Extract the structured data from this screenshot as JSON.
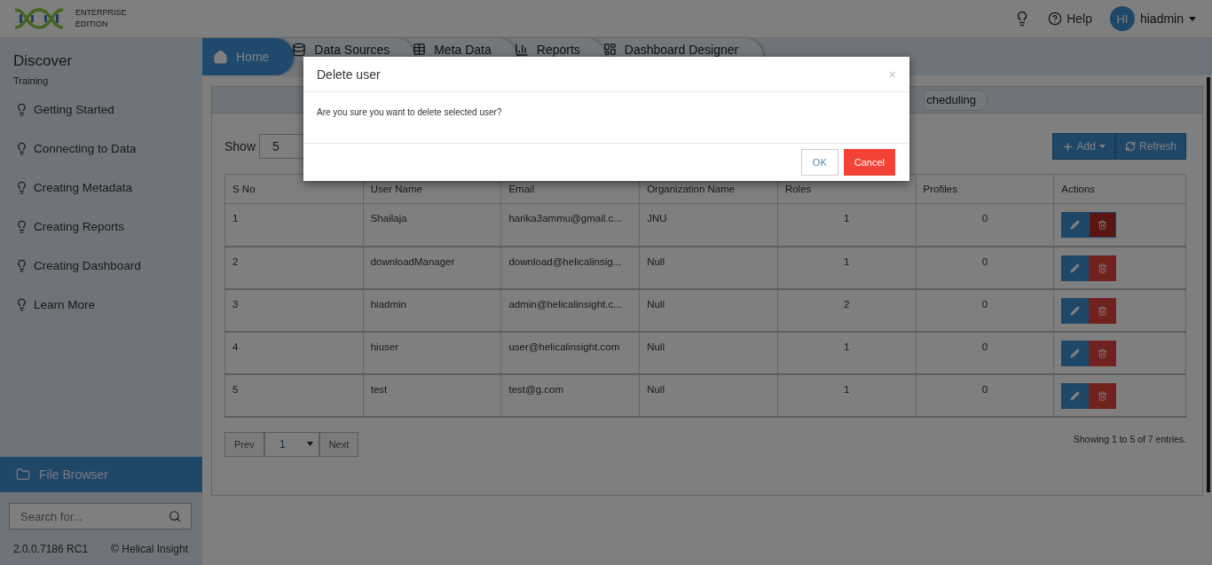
{
  "header": {
    "logo_lines": [
      "ENTERPRISE",
      "EDITION"
    ],
    "help": "Help",
    "avatar": "HI",
    "user": "hiadmin"
  },
  "sidebar": {
    "title": "Discover",
    "subtitle": "Training",
    "items": [
      "Getting Started",
      "Connecting to Data",
      "Creating Metadata",
      "Creating Reports",
      "Creating Dashboard",
      "Learn More"
    ],
    "file_browser": "File Browser",
    "search": {
      "placeholder": "Search for..."
    },
    "version": "2.0.0.7186 RC1",
    "copyright": "© Helical Insight"
  },
  "tabs": [
    {
      "label": "Home",
      "kind": "home",
      "selected": true
    },
    {
      "label": "Data Sources",
      "kind": "database",
      "selected": false
    },
    {
      "label": "Meta Data",
      "kind": "table",
      "selected": false
    },
    {
      "label": "Reports",
      "kind": "chart",
      "selected": false
    },
    {
      "label": "Dashboard Designer",
      "kind": "dashboard",
      "selected": false
    }
  ],
  "sub_tabs": [
    "cheduling"
  ],
  "show_label": "Show",
  "page_size": "5",
  "buttons": {
    "add": "Add",
    "refresh": "Refresh"
  },
  "table": {
    "columns": [
      "S No",
      "User Name",
      "Email",
      "Organization Name",
      "Roles",
      "Profiles",
      "Actions"
    ],
    "rows": [
      {
        "cells": [
          "1",
          "Shailaja",
          "harika3ammu@gmail.c...",
          "JNU",
          "1",
          "0"
        ],
        "delete_active": true
      },
      {
        "cells": [
          "2",
          "downloadManager",
          "download@helicalinsig...",
          "Null",
          "1",
          "0"
        ],
        "delete_active": false
      },
      {
        "cells": [
          "3",
          "hiadmin",
          "admin@helicalinsight.c...",
          "Null",
          "2",
          "0"
        ],
        "delete_active": false
      },
      {
        "cells": [
          "4",
          "hiuser",
          "user@helicalinsight.com",
          "Null",
          "1",
          "0"
        ],
        "delete_active": false
      },
      {
        "cells": [
          "5",
          "test",
          "test@g.com",
          "Null",
          "1",
          "0"
        ],
        "delete_active": false
      }
    ]
  },
  "pagination": {
    "prev": "Prev",
    "page": "1",
    "next": "Next"
  },
  "summary": "Showing 1 to 5 of 7 entries.",
  "dialog": {
    "title": "Delete user",
    "close": "×",
    "message": "Are you sure you want to delete selected user?",
    "ok": "OK",
    "cancel": "Cancel"
  }
}
